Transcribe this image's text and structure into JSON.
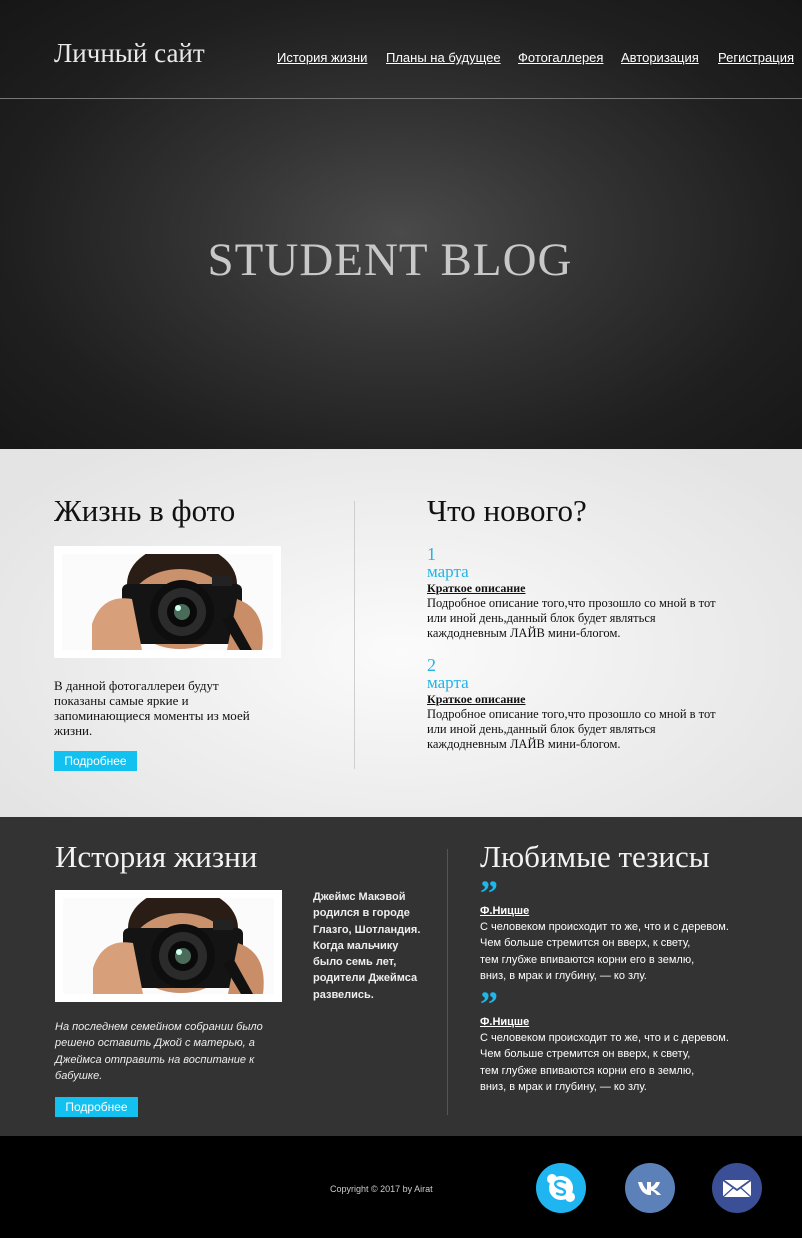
{
  "header": {
    "site_title": "Личный сайт",
    "nav": [
      "История жизни",
      "Планы на будущее",
      "Фотогаллерея",
      "Авторизация",
      "Регистрация"
    ]
  },
  "hero": {
    "title": "STUDENT BLOG"
  },
  "photo_section": {
    "heading": "Жизнь в фото",
    "description": "В данной фотогаллереи будут показаны самые яркие и запоминающиеся моменты из моей жизни.",
    "button": "Подробнее"
  },
  "news_section": {
    "heading": "Что нового?",
    "items": [
      {
        "day": "1",
        "month": "марта",
        "short": "Краткое описание",
        "full": "Подробное описание того,что прозошло со мной в тот или иной день,данный блок будет являться каждодневным ЛАЙВ мини-блогом."
      },
      {
        "day": "2",
        "month": "марта",
        "short": "Краткое описание",
        "full": "Подробное описание того,что прозошло со мной в тот или иной день,данный блок будет являться каждодневным ЛАЙВ мини-блогом."
      }
    ]
  },
  "history_section": {
    "heading": "История жизни",
    "bio": "Джеймс Макэвой родился в городе Глазго, Шотландия. Когда мальчику было семь лет, родители Джеймса развелись.",
    "italic": "На последнем семейном собрании было решено оставить Джой с матерью, а Джеймса отправить на воспитание к бабушке.",
    "button": "Подробнее"
  },
  "quotes_section": {
    "heading": "Любимые тезисы",
    "quotes": [
      {
        "mark": "”",
        "author": "Ф.Ницше",
        "lines": [
          "С человеком происходит то же, что и с деревом.",
          "Чем больше стремится он вверх, к свету,",
          "тем глубже впиваются корни его в землю,",
          "вниз, в мрак и глубину, — ко злу."
        ]
      },
      {
        "mark": "”",
        "author": "Ф.Ницше",
        "lines": [
          "С человеком происходит то же, что и с деревом.",
          "Чем больше стремится он вверх, к свету,",
          "тем глубже впиваются корни его в землю,",
          "вниз, в мрак и глубину, — ко злу."
        ]
      }
    ]
  },
  "footer": {
    "copyright": "Copyright © 2017 by Airat",
    "social": [
      {
        "icon": "skype-icon",
        "color": "#1fb5f0"
      },
      {
        "icon": "vk-icon",
        "color": "#5b81b8"
      },
      {
        "icon": "mail-icon",
        "color": "#3b4f96"
      }
    ]
  }
}
